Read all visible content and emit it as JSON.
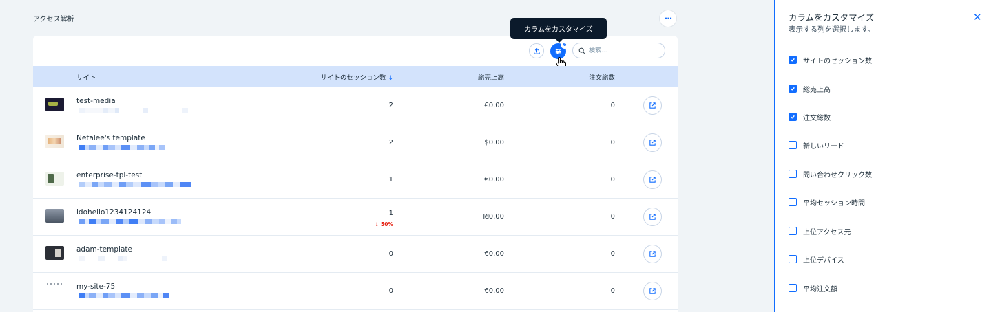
{
  "header": {
    "title": "アクセス解析",
    "more_label": "···"
  },
  "toolbar": {
    "columns_count": "6",
    "search_placeholder": "検索..."
  },
  "tooltip": {
    "text": "カラムをカスタマイズ"
  },
  "table": {
    "columns": {
      "site": "サイト",
      "sessions": "サイトのセッション数",
      "sales": "総売上高",
      "orders": "注文総数"
    },
    "rows": [
      {
        "name": "test-media",
        "sessions": "2",
        "sales": "€0.00",
        "orders": "0",
        "trend": ""
      },
      {
        "name": "Netalee's template",
        "sessions": "2",
        "sales": "$0.00",
        "orders": "0",
        "trend": ""
      },
      {
        "name": "enterprise-tpl-test",
        "sessions": "1",
        "sales": "€0.00",
        "orders": "0",
        "trend": ""
      },
      {
        "name": "idohello1234124124",
        "sessions": "1",
        "sales": "₪0.00",
        "orders": "0",
        "trend": "↓ 50%"
      },
      {
        "name": "adam-template",
        "sessions": "0",
        "sales": "€0.00",
        "orders": "0",
        "trend": ""
      },
      {
        "name": "my-site-75",
        "sessions": "0",
        "sales": "€0.00",
        "orders": "0",
        "trend": ""
      }
    ]
  },
  "panel": {
    "title": "カラムをカスタマイズ",
    "subtitle": "表示する列を選択します。",
    "items": [
      {
        "label": "サイトのセッション数",
        "checked": true
      },
      {
        "label": "総売上高",
        "checked": true
      },
      {
        "label": "注文総数",
        "checked": true
      },
      {
        "label": "新しいリード",
        "checked": false
      },
      {
        "label": "問い合わせクリック数",
        "checked": false
      },
      {
        "label": "平均セッション時間",
        "checked": false
      },
      {
        "label": "上位アクセス元",
        "checked": false
      },
      {
        "label": "上位デバイス",
        "checked": false
      },
      {
        "label": "平均注文額",
        "checked": false
      }
    ]
  },
  "colors": {
    "accent": "#116dff",
    "header_bg": "#d3e3fc",
    "trend_down": "#e62214",
    "tooltip_bg": "#0b1a2b"
  }
}
